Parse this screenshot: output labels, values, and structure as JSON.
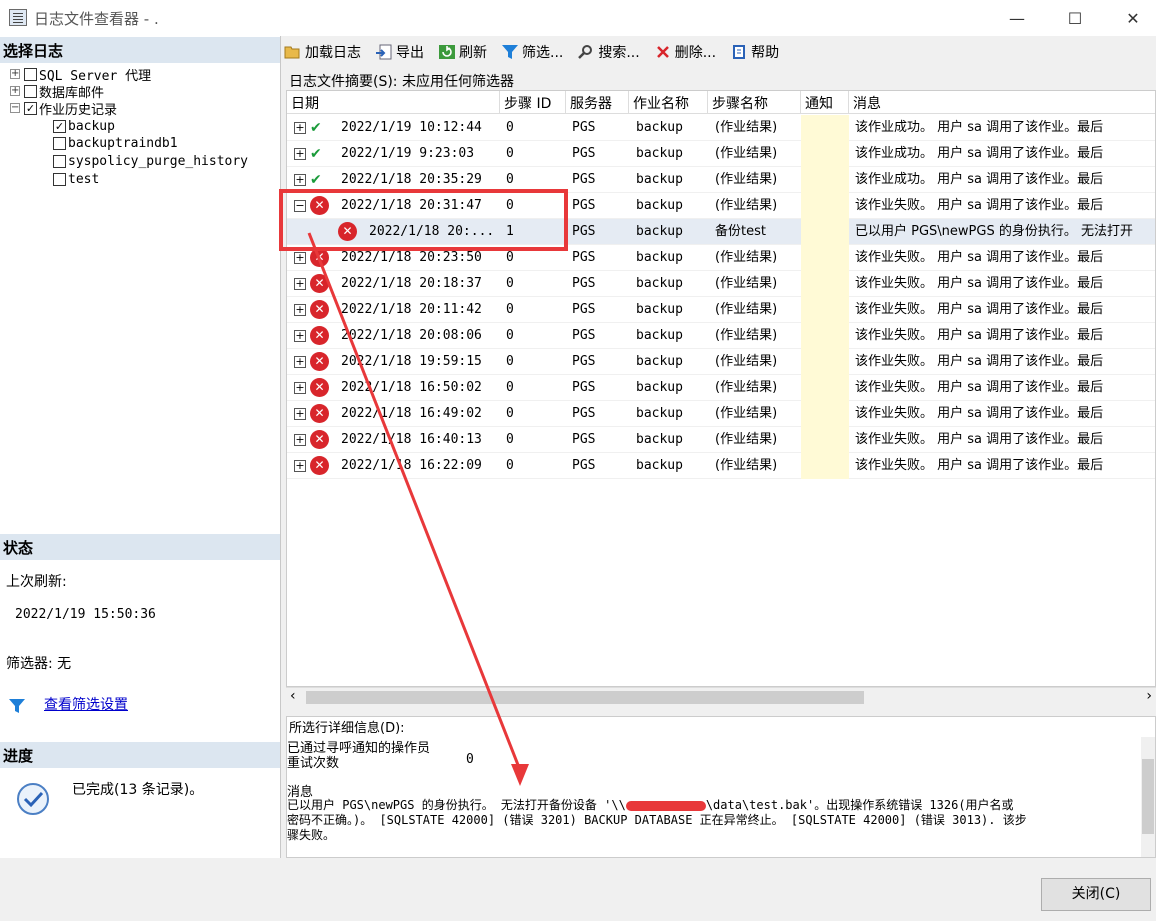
{
  "window": {
    "title": "日志文件查看器 - .",
    "minimize": "—",
    "maximize": "☐",
    "close": "✕"
  },
  "left": {
    "select_log_header": "选择日志",
    "tree": [
      {
        "label": "SQL Server 代理",
        "expander": "+",
        "checked": false
      },
      {
        "label": "数据库邮件",
        "expander": "+",
        "checked": false
      },
      {
        "label": "作业历史记录",
        "expander": "−",
        "checked": true
      },
      {
        "label": "backup",
        "checked": true
      },
      {
        "label": "backuptraindb1",
        "checked": false
      },
      {
        "label": "syspolicy_purge_history",
        "checked": false
      },
      {
        "label": "test",
        "checked": false
      }
    ],
    "status_header": "状态",
    "last_refresh_label": "上次刷新:",
    "last_refresh_value": "2022/1/19 15:50:36",
    "filter_label": "筛选器: 无",
    "view_filter_link": "查看筛选设置",
    "progress_header": "进度",
    "progress_text": "已完成(13 条记录)。"
  },
  "toolbar": {
    "load_log": "加载日志",
    "export": "导出",
    "refresh": "刷新",
    "filter": "筛选...",
    "search": "搜索...",
    "delete": "删除...",
    "help": "帮助"
  },
  "summary_label": "日志文件摘要(S): 未应用任何筛选器",
  "columns": [
    "日期",
    "步骤 ID",
    "服务器",
    "作业名称",
    "步骤名称",
    "通知",
    "消息"
  ],
  "rows": [
    {
      "expander": "+",
      "status": "ok",
      "date": "2022/1/19 10:12:44",
      "step_id": "0",
      "server": "PGS",
      "job": "backup",
      "step": "(作业结果)",
      "message": "该作业成功。 用户 sa 调用了该作业。最后"
    },
    {
      "expander": "+",
      "status": "ok",
      "date": "2022/1/19 9:23:03",
      "step_id": "0",
      "server": "PGS",
      "job": "backup",
      "step": "(作业结果)",
      "message": "该作业成功。 用户 sa 调用了该作业。最后"
    },
    {
      "expander": "+",
      "status": "ok",
      "date": "2022/1/18 20:35:29",
      "step_id": "0",
      "server": "PGS",
      "job": "backup",
      "step": "(作业结果)",
      "message": "该作业成功。 用户 sa 调用了该作业。最后"
    },
    {
      "expander": "−",
      "status": "err",
      "date": "2022/1/18 20:31:47",
      "step_id": "0",
      "server": "PGS",
      "job": "backup",
      "step": "(作业结果)",
      "message": "该作业失败。 用户 sa 调用了该作业。最后"
    },
    {
      "expander": "",
      "status": "err",
      "child": true,
      "date": "2022/1/18 20:...",
      "step_id": "1",
      "server": "PGS",
      "job": "backup",
      "step": "备份test",
      "message": "已以用户 PGS\\newPGS 的身份执行。 无法打开"
    },
    {
      "expander": "+",
      "status": "err",
      "date": "2022/1/18 20:23:50",
      "step_id": "0",
      "server": "PGS",
      "job": "backup",
      "step": "(作业结果)",
      "message": "该作业失败。 用户 sa 调用了该作业。最后"
    },
    {
      "expander": "+",
      "status": "err",
      "date": "2022/1/18 20:18:37",
      "step_id": "0",
      "server": "PGS",
      "job": "backup",
      "step": "(作业结果)",
      "message": "该作业失败。 用户 sa 调用了该作业。最后"
    },
    {
      "expander": "+",
      "status": "err",
      "date": "2022/1/18 20:11:42",
      "step_id": "0",
      "server": "PGS",
      "job": "backup",
      "step": "(作业结果)",
      "message": "该作业失败。 用户 sa 调用了该作业。最后"
    },
    {
      "expander": "+",
      "status": "err",
      "date": "2022/1/18 20:08:06",
      "step_id": "0",
      "server": "PGS",
      "job": "backup",
      "step": "(作业结果)",
      "message": "该作业失败。 用户 sa 调用了该作业。最后"
    },
    {
      "expander": "+",
      "status": "err",
      "date": "2022/1/18 19:59:15",
      "step_id": "0",
      "server": "PGS",
      "job": "backup",
      "step": "(作业结果)",
      "message": "该作业失败。 用户 sa 调用了该作业。最后"
    },
    {
      "expander": "+",
      "status": "err",
      "date": "2022/1/18 16:50:02",
      "step_id": "0",
      "server": "PGS",
      "job": "backup",
      "step": "(作业结果)",
      "message": "该作业失败。 用户 sa 调用了该作业。最后"
    },
    {
      "expander": "+",
      "status": "err",
      "date": "2022/1/18 16:49:02",
      "step_id": "0",
      "server": "PGS",
      "job": "backup",
      "step": "(作业结果)",
      "message": "该作业失败。 用户 sa 调用了该作业。最后"
    },
    {
      "expander": "+",
      "status": "err",
      "date": "2022/1/18 16:40:13",
      "step_id": "0",
      "server": "PGS",
      "job": "backup",
      "step": "(作业结果)",
      "message": "该作业失败。 用户 sa 调用了该作业。最后"
    },
    {
      "expander": "+",
      "status": "err",
      "date": "2022/1/18 16:22:09",
      "step_id": "0",
      "server": "PGS",
      "job": "backup",
      "step": "(作业结果)",
      "message": "该作业失败。 用户 sa 调用了该作业。最后"
    }
  ],
  "details": {
    "label": "所选行详细信息(D):",
    "operator_line": "已通过寻呼通知的操作员",
    "retry_label": "重试次数",
    "retry_value": "0",
    "message_label": "消息",
    "message_line1_a": "已以用户 PGS\\newPGS 的身份执行。 无法打开备份设备 '\\\\",
    "message_line1_b": "\\data\\test.bak'。出现操作系统错误 1326(用户名或",
    "message_line2": "密码不正确。)。 [SQLSTATE 42000] (错误 3201) BACKUP DATABASE 正在异常终止。 [SQLSTATE 42000] (错误 3013). 该步",
    "message_line3": "骤失败。"
  },
  "close_button": "关闭(C)",
  "colors": {
    "annotation_red": "#e8383a",
    "error_red": "#d8252b",
    "success_green": "#1a9b3a",
    "notify_yellow": "#fffad6",
    "section_blue": "#dce6f0"
  }
}
